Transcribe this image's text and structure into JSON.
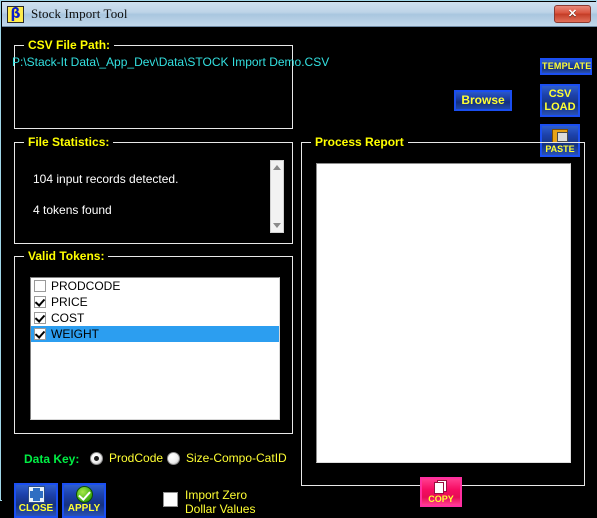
{
  "window": {
    "title": "Stock Import Tool",
    "icon": "stock-app-icon",
    "icon_glyph": "β",
    "close_label": "✕"
  },
  "csv_group": {
    "title": "CSV File Path:",
    "path": "P:\\Stack-It Data\\_App_Dev\\Data\\STOCK Import Demo.CSV",
    "browse_label": "Browse"
  },
  "side_buttons": {
    "template_label": "TEMPLATE",
    "csv_load_label": "CSV\nLOAD",
    "csv_load_line1": "CSV",
    "csv_load_line2": "LOAD",
    "paste_label": "PASTE"
  },
  "stats_group": {
    "title": "File Statistics:",
    "lines": [
      "104 input records detected.",
      "4 tokens found"
    ]
  },
  "tokens_group": {
    "title": "Valid Tokens:",
    "items": [
      {
        "label": "PRODCODE",
        "checked": false,
        "selected": false
      },
      {
        "label": "PRICE",
        "checked": true,
        "selected": false
      },
      {
        "label": "COST",
        "checked": true,
        "selected": false
      },
      {
        "label": "WEIGHT",
        "checked": true,
        "selected": true
      }
    ]
  },
  "data_key": {
    "label": "Data Key:",
    "options": [
      {
        "label": "ProdCode",
        "selected": true
      },
      {
        "label": "Size-Compo-CatID",
        "selected": false
      }
    ]
  },
  "actions": {
    "close_label": "CLOSE",
    "apply_label": "APPLY",
    "import_zero_label": "Import Zero\nDollar Values",
    "import_zero_checked": false
  },
  "report_group": {
    "title": "Process Report",
    "content": "",
    "copy_label": "COPY"
  },
  "colors": {
    "window_background": "#000000",
    "group_label": "#ffff00",
    "path_text": "#33e0e0",
    "stats_text": "#ffffff",
    "data_key_label": "#00ee44",
    "option_label": "#ffff33",
    "button_blue": "#1b4ff2",
    "button_pink": "#ff2fa0",
    "selection_blue": "#2c9ef0",
    "window_border": "#9fd6e8"
  }
}
